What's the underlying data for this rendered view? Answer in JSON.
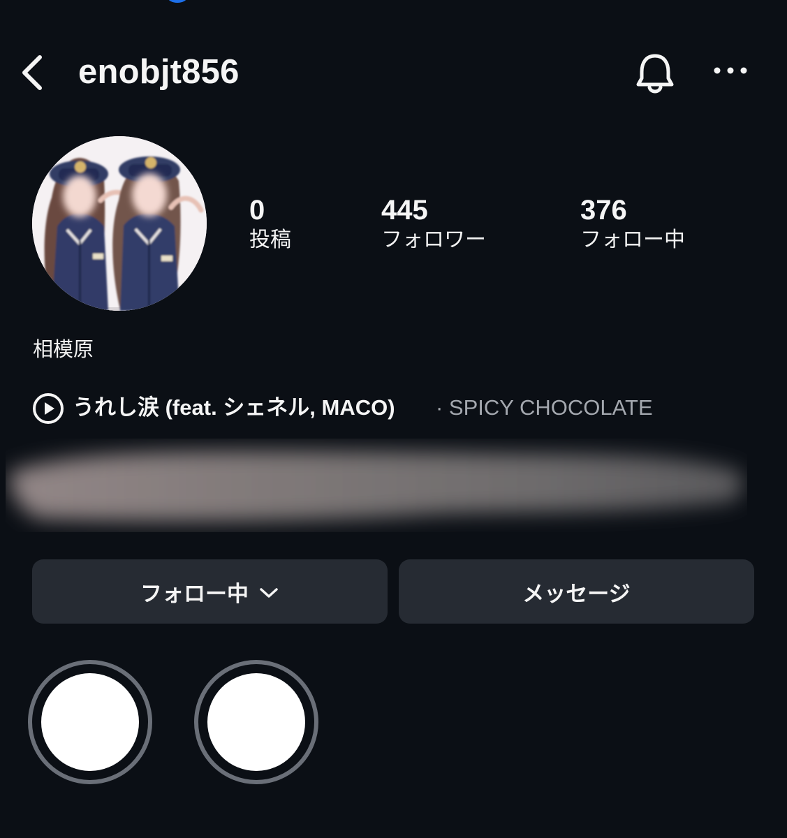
{
  "header": {
    "username": "enobjt856"
  },
  "profile": {
    "display_name": "相模原"
  },
  "stats": {
    "posts": {
      "count": "0",
      "label": "投稿"
    },
    "followers": {
      "count": "445",
      "label": "フォロワー"
    },
    "following": {
      "count": "376",
      "label": "フォロー中"
    }
  },
  "music": {
    "song": "うれし涙 (feat. シェネル, MACO)",
    "artist": "· SPICY CHOCOLATE"
  },
  "buttons": {
    "follow_label": "フォロー中",
    "message_label": "メッセージ"
  },
  "icons": {
    "back": "back-icon",
    "bell": "bell-icon",
    "more": "more-icon",
    "play": "play-icon",
    "chevron": "chevron-down-icon"
  },
  "colors": {
    "background": "#0b0f15",
    "button": "#262b33",
    "muted_text": "#a4a8af",
    "highlight_ring": "#6a6f78",
    "accent_dot": "#1d6fe8"
  }
}
